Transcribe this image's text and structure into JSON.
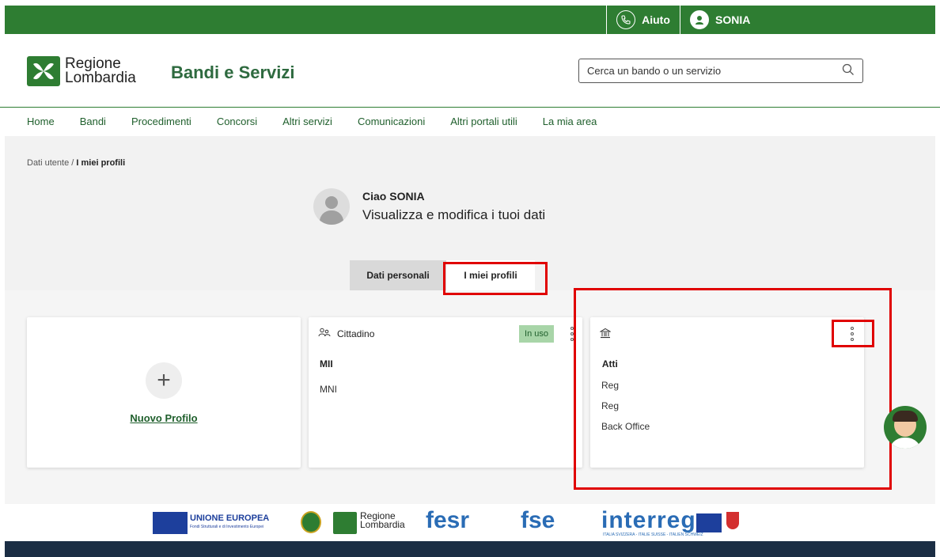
{
  "topbar": {
    "help_label": "Aiuto",
    "user_label": "SONIA"
  },
  "header": {
    "logo_line1": "Regione",
    "logo_line2": "Lombardia",
    "site_title": "Bandi e Servizi",
    "search_placeholder": "Cerca un bando o un servizio"
  },
  "nav": {
    "items": [
      "Home",
      "Bandi",
      "Procedimenti",
      "Concorsi",
      "Altri servizi",
      "Comunicazioni",
      "Altri portali utili",
      "La mia area"
    ]
  },
  "breadcrumb": {
    "parent": "Dati utente",
    "separator": "/",
    "current": "I miei profili"
  },
  "profile": {
    "greeting": "Ciao SONIA",
    "subtitle": "Visualizza e modifica i tuoi dati"
  },
  "tabs": [
    {
      "label": "Dati personali",
      "active": false
    },
    {
      "label": "I miei profili",
      "active": true
    }
  ],
  "cards": {
    "new_profile_label": "Nuovo Profilo",
    "citizen": {
      "title": "Cittadino",
      "badge": "In uso",
      "line1": "MII",
      "line2": "MNI"
    },
    "institution": {
      "title": "",
      "line1": "​ Atti",
      "line2": "Reɡ",
      "line3": "Reg",
      "line4": "Back Office"
    }
  },
  "footer_logos": {
    "eu_title": "UNIONE EUROPEA",
    "eu_sub": "Fondi Strutturali e di Investimento Europei",
    "rl_line1": "Regione",
    "rl_line2": "Lombardia",
    "fesr": "fesr",
    "fse": "fse",
    "interreg": "interreg",
    "interreg_sub": "ITALIA SVIZZERA - ITALIE SUISSE - ITALIEN SCHWEIZ"
  },
  "colors": {
    "brand_green": "#2e7d32",
    "highlight_red": "#e00000",
    "badge_green": "#a8d5a8",
    "footer_navy": "#1b2e44"
  }
}
